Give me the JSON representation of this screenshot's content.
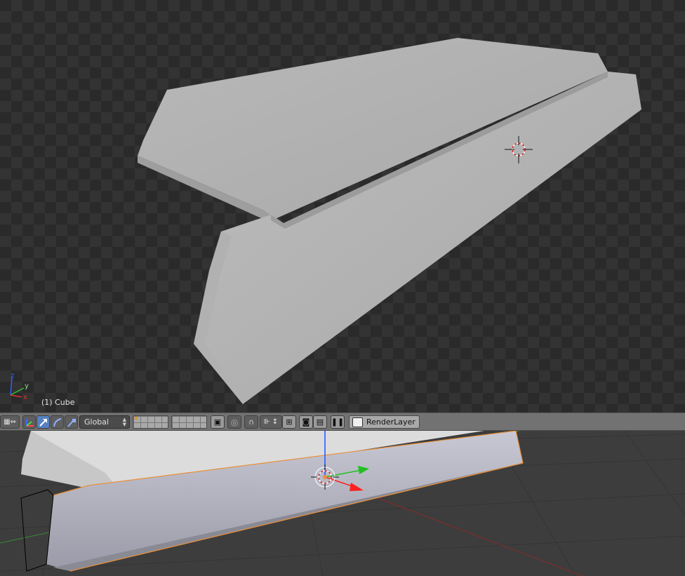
{
  "render_viewport": {
    "object_label": "(1) Cube",
    "axis_labels": {
      "x": "x",
      "y": "y",
      "z": "z"
    }
  },
  "header": {
    "transform_orientation": "Global",
    "render_layer": "RenderLayer"
  },
  "icons": {
    "view_toggle": "view-toggle-icon",
    "transform_manipulator": "manipulator-icon",
    "translate": "translate-arrow-icon",
    "rotate": "rotate-arc-icon",
    "scale": "scale-icon",
    "layers_a": "layers-grid-icon",
    "layers_b": "layers-grid-icon",
    "lock_camera": "lock-icon",
    "proportional": "proportional-edit-icon",
    "snap": "magnet-icon",
    "snap_element": "snap-element-icon",
    "render_still": "camera-icon",
    "render_anim": "clapper-icon",
    "pause": "pause-icon",
    "render_layer": "render-layer-icon"
  },
  "colors": {
    "active_button": "#5680c2",
    "selection_outline": "#e8903a",
    "axis_x": "#ff2020",
    "axis_y": "#20c020",
    "axis_z": "#2050ff"
  }
}
